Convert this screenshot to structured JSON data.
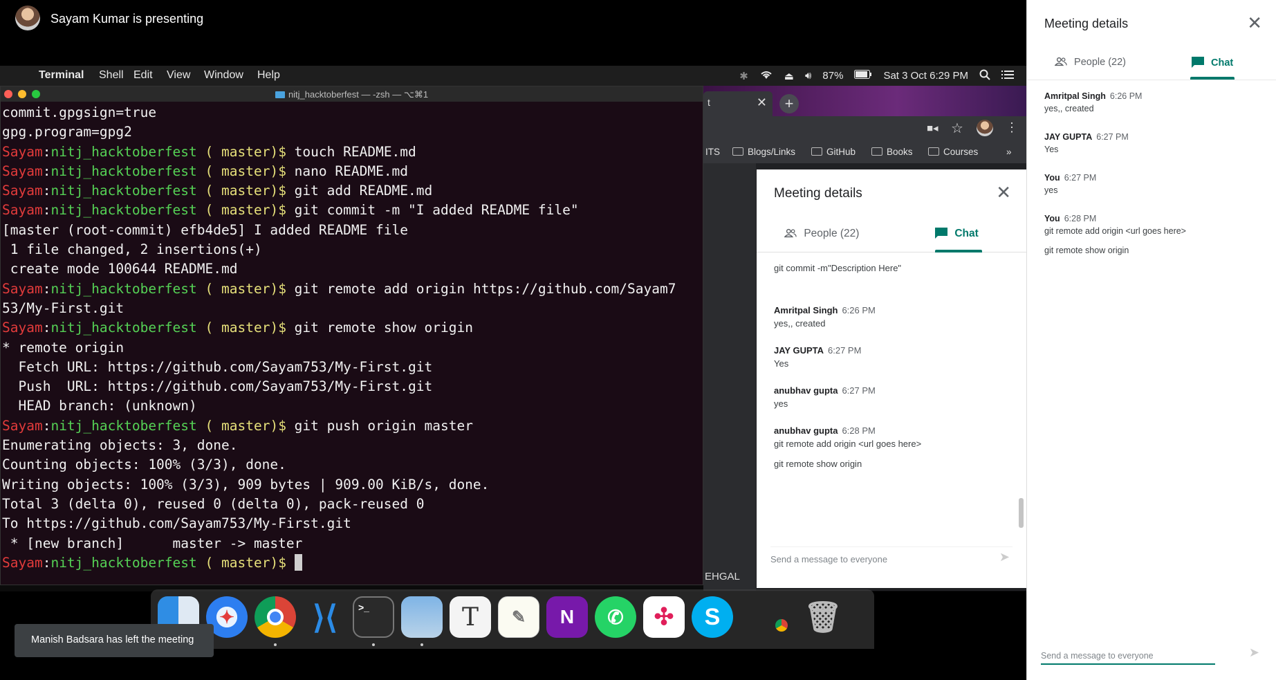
{
  "presenter": {
    "text": "Sayam Kumar is presenting"
  },
  "menubar": {
    "items": [
      "Terminal",
      "Shell",
      "Edit",
      "View",
      "Window",
      "Help"
    ],
    "battery": "87%",
    "datetime": "Sat 3 Oct  6:29 PM"
  },
  "terminal": {
    "title": "nitj_hacktoberfest — -zsh — ⌥⌘1",
    "prompt": {
      "user": "Sayam",
      "dir": "nitj_hacktoberfest",
      "branch": "( master)$"
    },
    "lines": [
      {
        "kind": "out",
        "text": "commit.gpgsign=true"
      },
      {
        "kind": "out",
        "text": "gpg.program=gpg2"
      },
      {
        "kind": "cmd",
        "text": " touch README.md"
      },
      {
        "kind": "cmd",
        "text": " nano README.md"
      },
      {
        "kind": "cmd",
        "text": " git add README.md"
      },
      {
        "kind": "cmd",
        "text": " git commit -m \"I added README file\""
      },
      {
        "kind": "out",
        "text": "[master (root-commit) efb4de5] I added README file"
      },
      {
        "kind": "out",
        "text": " 1 file changed, 2 insertions(+)"
      },
      {
        "kind": "out",
        "text": " create mode 100644 README.md"
      },
      {
        "kind": "cmd",
        "text": " git remote add origin https://github.com/Sayam7"
      },
      {
        "kind": "out",
        "text": "53/My-First.git"
      },
      {
        "kind": "cmd",
        "text": " git remote show origin"
      },
      {
        "kind": "out",
        "text": "* remote origin"
      },
      {
        "kind": "out",
        "text": "  Fetch URL: https://github.com/Sayam753/My-First.git"
      },
      {
        "kind": "out",
        "text": "  Push  URL: https://github.com/Sayam753/My-First.git"
      },
      {
        "kind": "out",
        "text": "  HEAD branch: (unknown)"
      },
      {
        "kind": "cmd",
        "text": " git push origin master"
      },
      {
        "kind": "out",
        "text": "Enumerating objects: 3, done."
      },
      {
        "kind": "out",
        "text": "Counting objects: 100% (3/3), done."
      },
      {
        "kind": "out",
        "text": "Writing objects: 100% (3/3), 909 bytes | 909.00 KiB/s, done."
      },
      {
        "kind": "out",
        "text": "Total 3 (delta 0), reused 0 (delta 0), pack-reused 0"
      },
      {
        "kind": "out",
        "text": "To https://github.com/Sayam753/My-First.git"
      },
      {
        "kind": "out",
        "text": " * [new branch]      master -> master"
      },
      {
        "kind": "prompt",
        "text": " "
      }
    ]
  },
  "browser": {
    "tab_label": "t",
    "bookmarks": [
      "ITS",
      "Blogs/Links",
      "GitHub",
      "Books",
      "Courses"
    ],
    "bottom_text": "EHGAL"
  },
  "inner_panel": {
    "title": "Meeting details",
    "people_tab": "People (22)",
    "chat_tab": "Chat",
    "first_line": "git commit -m\"Description Here\"",
    "messages": [
      {
        "sender": "Amritpal Singh",
        "time": "6:26 PM",
        "lines": [
          "yes,, created"
        ]
      },
      {
        "sender": "JAY GUPTA",
        "time": "6:27 PM",
        "lines": [
          "Yes"
        ]
      },
      {
        "sender": "anubhav gupta",
        "time": "6:27 PM",
        "lines": [
          "yes"
        ]
      },
      {
        "sender": "anubhav gupta",
        "time": "6:28 PM",
        "lines": [
          "git remote add origin <url goes here>",
          "git remote show origin"
        ]
      }
    ],
    "input_placeholder": "Send a message to everyone"
  },
  "dock": {
    "apps": [
      "finder-icon",
      "safari-icon",
      "chrome-icon",
      "vscode-icon",
      "terminal-icon",
      "preview-icon",
      "textedit-icon",
      "notes-icon",
      "onenote-icon",
      "whatsapp-icon",
      "slack-icon",
      "skype-icon",
      "chrome-app-icon",
      "trash-icon"
    ]
  },
  "toast": {
    "text": "Manish Badsara has left the meeting"
  },
  "side_panel": {
    "title": "Meeting details",
    "people_tab": "People (22)",
    "chat_tab": "Chat",
    "messages": [
      {
        "sender": "Amritpal Singh",
        "time": "6:26 PM",
        "lines": [
          "yes,, created"
        ]
      },
      {
        "sender": "JAY GUPTA",
        "time": "6:27 PM",
        "lines": [
          "Yes"
        ]
      },
      {
        "sender": "You",
        "time": "6:27 PM",
        "lines": [
          "yes"
        ]
      },
      {
        "sender": "You",
        "time": "6:28 PM",
        "lines": [
          "git remote add origin <url goes here>",
          "git remote show origin"
        ]
      }
    ],
    "input_placeholder": "Send a message to everyone"
  }
}
